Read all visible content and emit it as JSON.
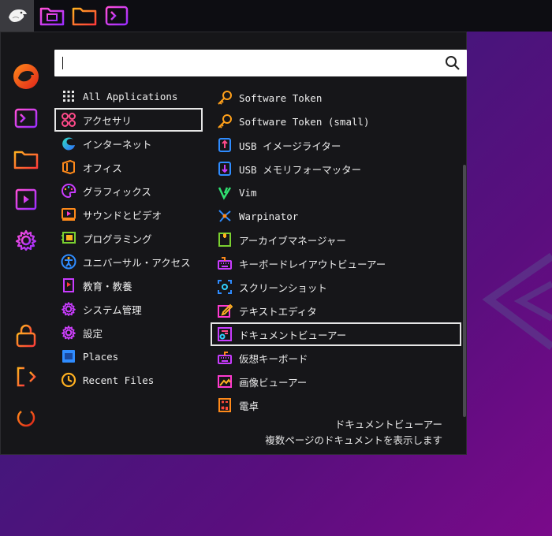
{
  "taskbar": {
    "items": [
      {
        "name": "start-menu",
        "icon": "eagle-logo-icon"
      },
      {
        "name": "computer",
        "icon": "computer-folder-icon"
      },
      {
        "name": "files",
        "icon": "folder-icon"
      },
      {
        "name": "terminal",
        "icon": "terminal-icon"
      }
    ]
  },
  "sidebar": {
    "items": [
      {
        "icon": "user-avatar-icon"
      },
      {
        "icon": "terminal-icon"
      },
      {
        "icon": "folder-icon"
      },
      {
        "icon": "video-icon"
      },
      {
        "icon": "settings-icon"
      },
      {
        "icon": "lock-icon"
      },
      {
        "icon": "logout-icon"
      },
      {
        "icon": "power-icon"
      }
    ]
  },
  "search": {
    "value": "",
    "placeholder": ""
  },
  "categories": [
    {
      "label": "All Applications",
      "icon": "grid-icon"
    },
    {
      "label": "アクセサリ",
      "icon": "accessories-icon"
    },
    {
      "label": "インターネット",
      "icon": "internet-icon"
    },
    {
      "label": "オフィス",
      "icon": "office-icon"
    },
    {
      "label": "グラフィックス",
      "icon": "graphics-icon"
    },
    {
      "label": "サウンドとビデオ",
      "icon": "multimedia-icon"
    },
    {
      "label": "プログラミング",
      "icon": "programming-icon"
    },
    {
      "label": "ユニバーサル・アクセス",
      "icon": "accessibility-icon"
    },
    {
      "label": "教育・教養",
      "icon": "education-icon"
    },
    {
      "label": "システム管理",
      "icon": "system-icon"
    },
    {
      "label": "設定",
      "icon": "settings-icon"
    },
    {
      "label": "Places",
      "icon": "places-icon"
    },
    {
      "label": "Recent Files",
      "icon": "recent-icon"
    }
  ],
  "apps": [
    {
      "label": "Software Token",
      "icon": "key-icon"
    },
    {
      "label": "Software Token (small)",
      "icon": "key-icon"
    },
    {
      "label": "USB イメージライター",
      "icon": "usb-icon"
    },
    {
      "label": "USB メモリフォーマッター",
      "icon": "usb-icon"
    },
    {
      "label": "Vim",
      "icon": "vim-icon"
    },
    {
      "label": "Warpinator",
      "icon": "warpinator-icon"
    },
    {
      "label": "アーカイブマネージャー",
      "icon": "archive-icon"
    },
    {
      "label": "キーボードレイアウトビューアー",
      "icon": "keyboard-layout-icon"
    },
    {
      "label": "スクリーンショット",
      "icon": "screenshot-icon"
    },
    {
      "label": "テキストエディタ",
      "icon": "text-editor-icon"
    },
    {
      "label": "ドキュメントビューアー",
      "icon": "document-viewer-icon"
    },
    {
      "label": "仮想キーボード",
      "icon": "virtual-keyboard-icon"
    },
    {
      "label": "画像ビューアー",
      "icon": "image-viewer-icon"
    },
    {
      "label": "電卓",
      "icon": "calculator-icon"
    }
  ],
  "selected_category": "アクセサリ",
  "selected_app": "ドキュメントビューアー",
  "description": {
    "title": "ドキュメントビューアー",
    "text": "複数ページのドキュメントを表示します"
  },
  "colors": {
    "accent_orange": "#ff7a1a",
    "accent_magenta": "#c93cff",
    "accent_blue": "#2f8cff",
    "panel_bg": "#161619"
  }
}
